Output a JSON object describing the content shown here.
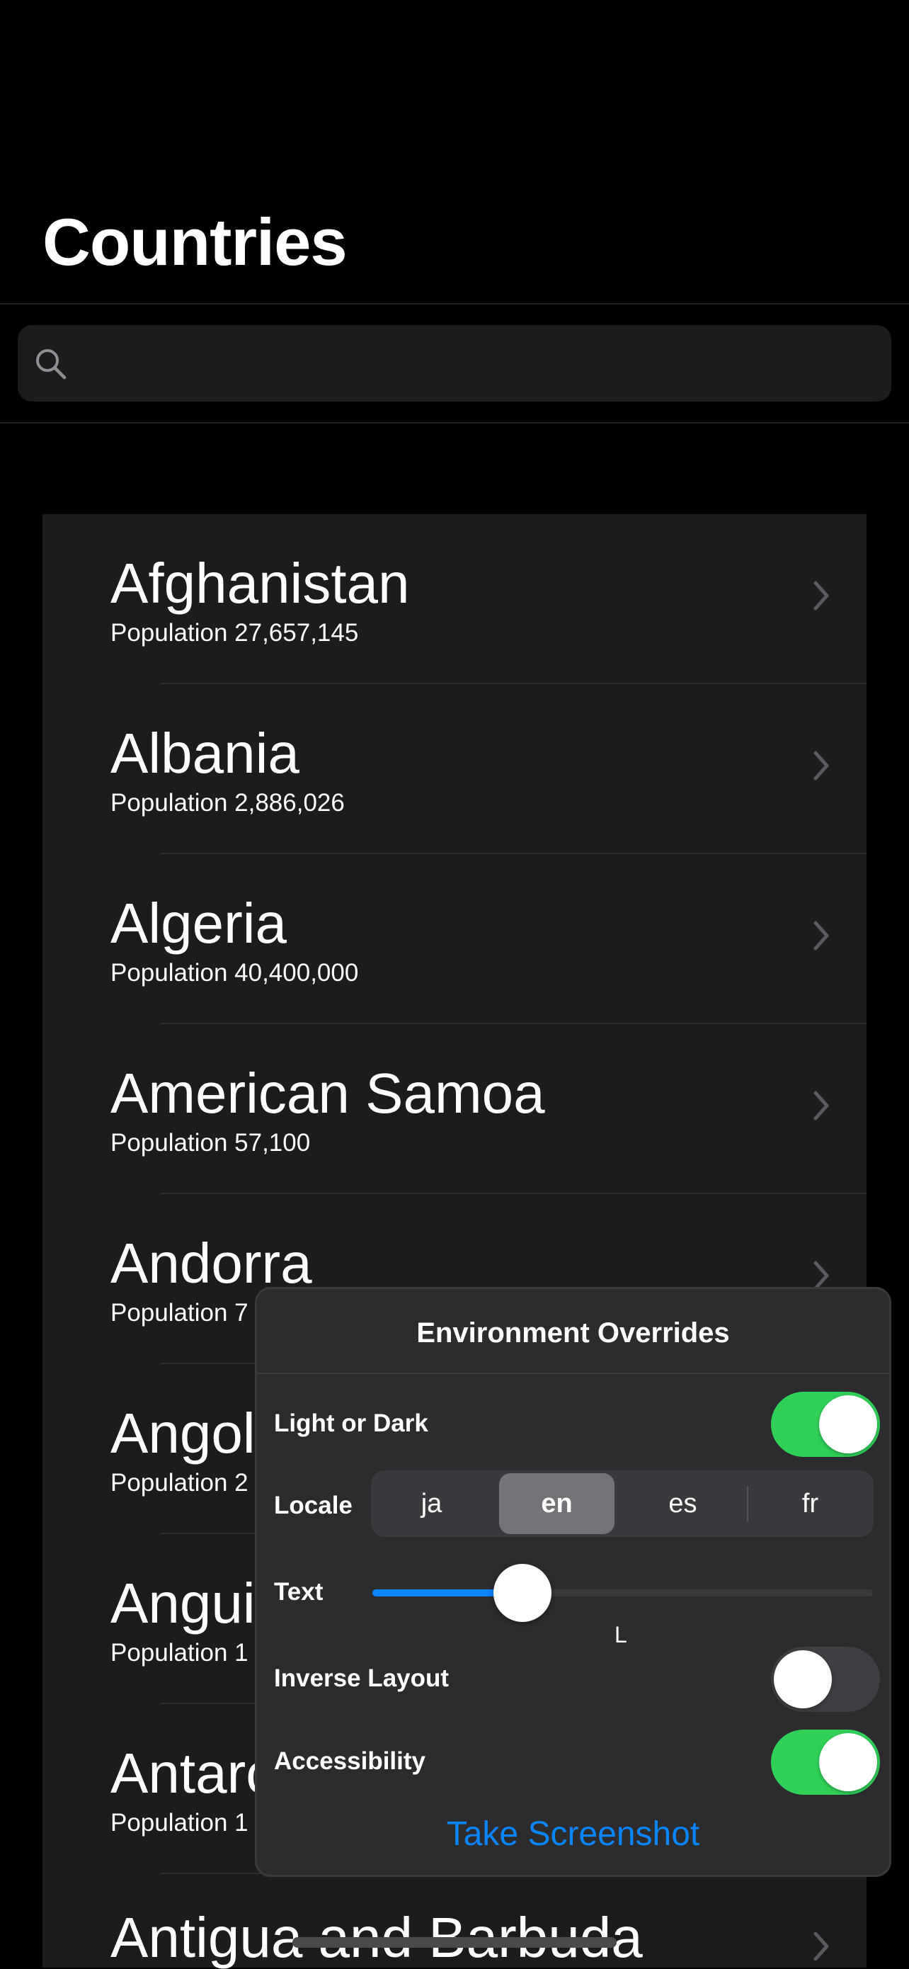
{
  "header": {
    "title": "Countries"
  },
  "search": {
    "placeholder": "",
    "icon": "magnifying-glass-icon"
  },
  "countries": [
    {
      "name": "Afghanistan",
      "population": "Population 27,657,145"
    },
    {
      "name": "Albania",
      "population": "Population 2,886,026"
    },
    {
      "name": "Algeria",
      "population": "Population 40,400,000"
    },
    {
      "name": "American Samoa",
      "population": "Population 57,100"
    },
    {
      "name": "Andorra",
      "population": "Population 7"
    },
    {
      "name": "Angol",
      "population": "Population 2"
    },
    {
      "name": "Angui",
      "population": "Population 1"
    },
    {
      "name": "Antarc",
      "population": "Population 1"
    },
    {
      "name": "Antigua and Barbuda",
      "population": ""
    }
  ],
  "overrides": {
    "title": "Environment Overrides",
    "light_or_dark": {
      "label": "Light or Dark",
      "on": true
    },
    "locale": {
      "label": "Locale",
      "options": [
        "ja",
        "en",
        "es",
        "fr"
      ],
      "selected": "en"
    },
    "text": {
      "label": "Text",
      "value_label": "L",
      "level": 0.3
    },
    "inverse_layout": {
      "label": "Inverse Layout",
      "on": false
    },
    "accessibility": {
      "label": "Accessibility",
      "on": true
    },
    "take_screenshot": "Take Screenshot"
  },
  "colors": {
    "accent": "#0a84ff",
    "toggle_on": "#30d158",
    "background": "#000000",
    "cell": "#1c1c1e"
  }
}
